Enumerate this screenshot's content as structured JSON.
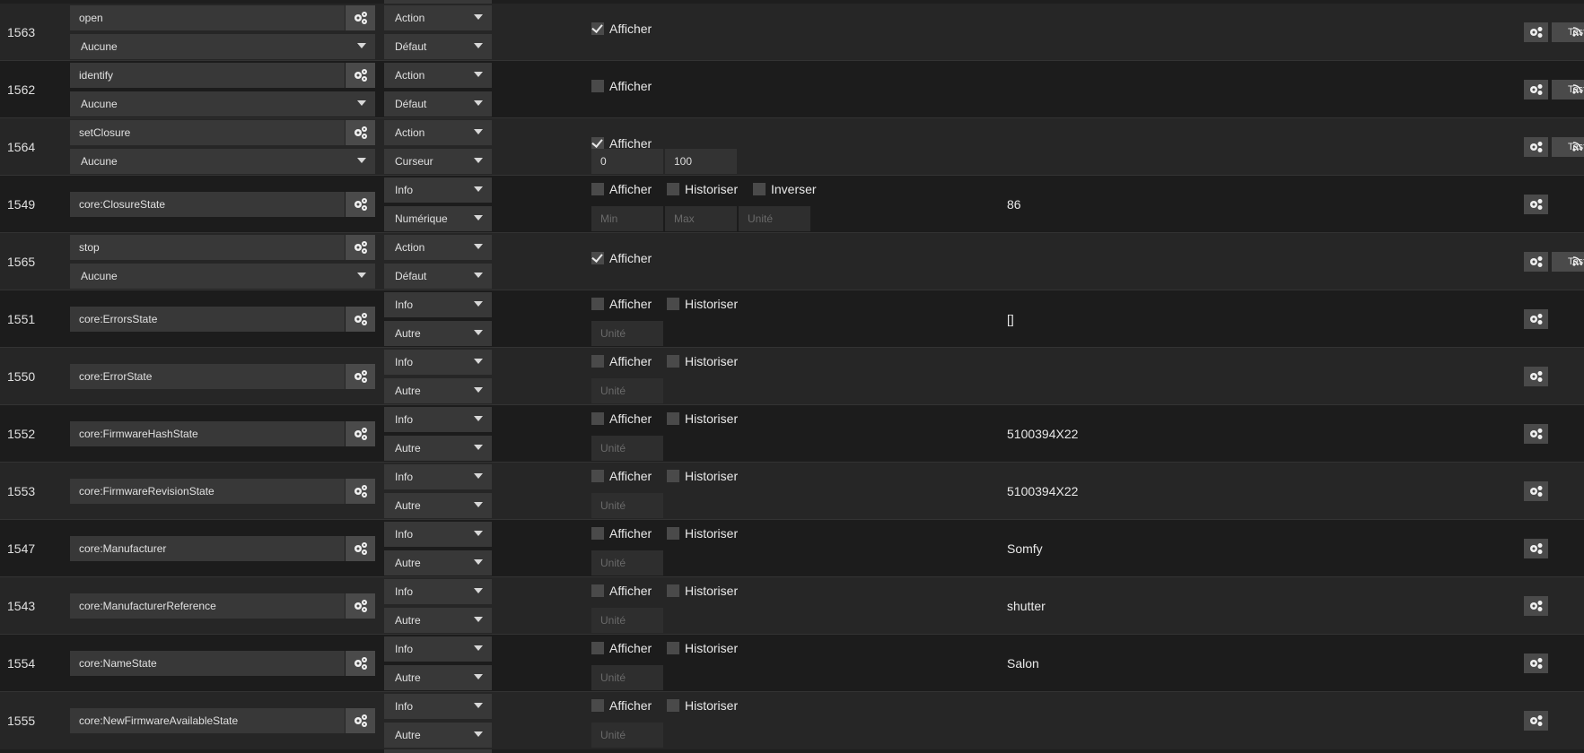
{
  "rows": [
    {
      "id": "1563",
      "name": "open",
      "sub": "Aucune",
      "type": "Action",
      "subtype": "Défaut",
      "afficher": true,
      "historiser": null,
      "inverser": null,
      "inputs": [],
      "value": "",
      "test": true
    },
    {
      "id": "1562",
      "name": "identify",
      "sub": "Aucune",
      "type": "Action",
      "subtype": "Défaut",
      "afficher": false,
      "historiser": null,
      "inverser": null,
      "inputs": [],
      "value": "",
      "test": true
    },
    {
      "id": "1564",
      "name": "setClosure",
      "sub": "Aucune",
      "type": "Action",
      "subtype": "Curseur",
      "afficher": true,
      "historiser": null,
      "inverser": null,
      "inputs": [
        {
          "value": "0"
        },
        {
          "value": "100"
        }
      ],
      "value": "",
      "test": true
    },
    {
      "id": "1549",
      "name": "core:ClosureState",
      "sub": null,
      "type": "Info",
      "subtype": "Numérique",
      "afficher": false,
      "historiser": false,
      "inverser": false,
      "inputs": [
        {
          "placeholder": "Min"
        },
        {
          "placeholder": "Max"
        },
        {
          "placeholder": "Unité"
        }
      ],
      "value": "86",
      "test": false
    },
    {
      "id": "1565",
      "name": "stop",
      "sub": "Aucune",
      "type": "Action",
      "subtype": "Défaut",
      "afficher": true,
      "historiser": null,
      "inverser": null,
      "inputs": [],
      "value": "",
      "test": true
    },
    {
      "id": "1551",
      "name": "core:ErrorsState",
      "sub": null,
      "type": "Info",
      "subtype": "Autre",
      "afficher": false,
      "historiser": false,
      "inverser": null,
      "inputs": [
        {
          "placeholder": "Unité"
        }
      ],
      "value": "[]",
      "test": false
    },
    {
      "id": "1550",
      "name": "core:ErrorState",
      "sub": null,
      "type": "Info",
      "subtype": "Autre",
      "afficher": false,
      "historiser": false,
      "inverser": null,
      "inputs": [
        {
          "placeholder": "Unité"
        }
      ],
      "value": "",
      "test": false
    },
    {
      "id": "1552",
      "name": "core:FirmwareHashState",
      "sub": null,
      "type": "Info",
      "subtype": "Autre",
      "afficher": false,
      "historiser": false,
      "inverser": null,
      "inputs": [
        {
          "placeholder": "Unité"
        }
      ],
      "value": "5100394X22",
      "test": false
    },
    {
      "id": "1553",
      "name": "core:FirmwareRevisionState",
      "sub": null,
      "type": "Info",
      "subtype": "Autre",
      "afficher": false,
      "historiser": false,
      "inverser": null,
      "inputs": [
        {
          "placeholder": "Unité"
        }
      ],
      "value": "5100394X22",
      "test": false
    },
    {
      "id": "1547",
      "name": "core:Manufacturer",
      "sub": null,
      "type": "Info",
      "subtype": "Autre",
      "afficher": false,
      "historiser": false,
      "inverser": null,
      "inputs": [
        {
          "placeholder": "Unité"
        }
      ],
      "value": "Somfy",
      "test": false
    },
    {
      "id": "1543",
      "name": "core:ManufacturerReference",
      "sub": null,
      "type": "Info",
      "subtype": "Autre",
      "afficher": false,
      "historiser": false,
      "inverser": null,
      "inputs": [
        {
          "placeholder": "Unité"
        }
      ],
      "value": "shutter",
      "test": false
    },
    {
      "id": "1554",
      "name": "core:NameState",
      "sub": null,
      "type": "Info",
      "subtype": "Autre",
      "afficher": false,
      "historiser": false,
      "inverser": null,
      "inputs": [
        {
          "placeholder": "Unité"
        }
      ],
      "value": "Salon",
      "test": false
    },
    {
      "id": "1555",
      "name": "core:NewFirmwareAvailableState",
      "sub": null,
      "type": "Info",
      "subtype": "Autre",
      "afficher": false,
      "historiser": false,
      "inverser": null,
      "inputs": [
        {
          "placeholder": "Unité"
        }
      ],
      "value": "",
      "test": false
    }
  ],
  "labels": {
    "afficher": "Afficher",
    "historiser": "Historiser",
    "inverser": "Inverser",
    "test": "Tester"
  },
  "icons": {
    "config": "cogs-icon",
    "gear": "gear-icon",
    "test": "rss-icon"
  },
  "colors": {
    "row_odd": "#262626",
    "row_even": "#1c1c1c",
    "field": "#383838",
    "button": "#4a4a4a",
    "text": "#e0e0e0"
  }
}
